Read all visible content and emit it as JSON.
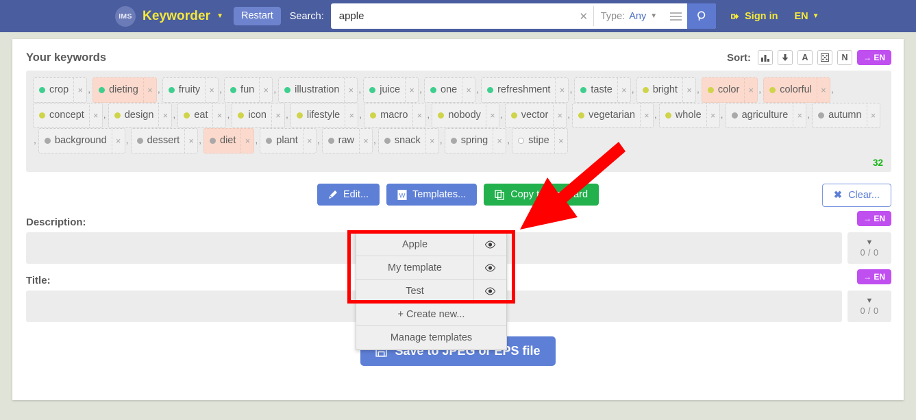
{
  "header": {
    "logo_text": "IMS",
    "brand": "Keyworder",
    "restart_label": "Restart",
    "search_label": "Search:",
    "search_value": "apple",
    "search_placeholder": "Search",
    "clear_icon": "close-icon",
    "type_label": "Type:",
    "type_value": "Any",
    "menu_icon": "hamburger-menu-icon",
    "search_icon": "magnifier-icon",
    "signin_label": "Sign in",
    "signin_icon": "sign-in-icon",
    "lang_label": "EN"
  },
  "keywords_panel": {
    "title": "Your keywords",
    "sort_label": "Sort:",
    "sort_buttons": [
      {
        "name": "sort-by-frequency",
        "icon": "bar-chart-icon",
        "label": ""
      },
      {
        "name": "sort-descending",
        "icon": "arrow-down-icon",
        "label": ""
      },
      {
        "name": "sort-alphabetical",
        "icon": "",
        "label": "A"
      },
      {
        "name": "sort-random",
        "icon": "dice-icon",
        "label": ""
      },
      {
        "name": "sort-natural",
        "icon": "",
        "label": "N"
      }
    ],
    "translate_label": "→ EN",
    "count": "32",
    "remove_icon": "close-icon",
    "separator": ",",
    "keywords": [
      {
        "text": "crop",
        "color": "#3ecf8e",
        "highlight": false
      },
      {
        "text": "dieting",
        "color": "#3ecf8e",
        "highlight": true
      },
      {
        "text": "fruity",
        "color": "#3ecf8e",
        "highlight": false
      },
      {
        "text": "fun",
        "color": "#3ecf8e",
        "highlight": false
      },
      {
        "text": "illustration",
        "color": "#3ecf8e",
        "highlight": false
      },
      {
        "text": "juice",
        "color": "#3ecf8e",
        "highlight": false
      },
      {
        "text": "one",
        "color": "#3ecf8e",
        "highlight": false
      },
      {
        "text": "refreshment",
        "color": "#3ecf8e",
        "highlight": false
      },
      {
        "text": "taste",
        "color": "#3ecf8e",
        "highlight": false
      },
      {
        "text": "bright",
        "color": "#cfd44a",
        "highlight": false
      },
      {
        "text": "color",
        "color": "#cfd44a",
        "highlight": true
      },
      {
        "text": "colorful",
        "color": "#cfd44a",
        "highlight": true
      },
      {
        "text": "concept",
        "color": "#cfd44a",
        "highlight": false
      },
      {
        "text": "design",
        "color": "#cfd44a",
        "highlight": false
      },
      {
        "text": "eat",
        "color": "#cfd44a",
        "highlight": false
      },
      {
        "text": "icon",
        "color": "#cfd44a",
        "highlight": false
      },
      {
        "text": "lifestyle",
        "color": "#cfd44a",
        "highlight": false
      },
      {
        "text": "macro",
        "color": "#cfd44a",
        "highlight": false
      },
      {
        "text": "nobody",
        "color": "#cfd44a",
        "highlight": false
      },
      {
        "text": "vector",
        "color": "#cfd44a",
        "highlight": false
      },
      {
        "text": "vegetarian",
        "color": "#cfd44a",
        "highlight": false
      },
      {
        "text": "whole",
        "color": "#cfd44a",
        "highlight": false
      },
      {
        "text": "agriculture",
        "color": "#a9a9a9",
        "highlight": false
      },
      {
        "text": "autumn",
        "color": "#a9a9a9",
        "highlight": false
      },
      {
        "text": "background",
        "color": "#a9a9a9",
        "highlight": false
      },
      {
        "text": "dessert",
        "color": "#a9a9a9",
        "highlight": false
      },
      {
        "text": "diet",
        "color": "#a9a9a9",
        "highlight": true
      },
      {
        "text": "plant",
        "color": "#a9a9a9",
        "highlight": false
      },
      {
        "text": "raw",
        "color": "#a9a9a9",
        "highlight": false
      },
      {
        "text": "snack",
        "color": "#a9a9a9",
        "highlight": false
      },
      {
        "text": "spring",
        "color": "#a9a9a9",
        "highlight": false
      },
      {
        "text": "stipe",
        "color": "#ffffff",
        "highlight": false
      }
    ]
  },
  "actions": {
    "edit_label": "Edit...",
    "edit_icon": "pencil-icon",
    "templates_label": "Templates...",
    "templates_icon": "document-icon",
    "copy_label": "Copy to clipboard",
    "copy_icon": "copy-icon",
    "clear_label": "Clear...",
    "clear_icon": "x-mark-icon"
  },
  "templates_dropdown": {
    "items": [
      {
        "label": "Apple",
        "eye_icon": "eye-icon"
      },
      {
        "label": "My template",
        "eye_icon": "eye-icon"
      },
      {
        "label": "Test",
        "eye_icon": "eye-icon"
      }
    ],
    "create_new_label": "+ Create new...",
    "manage_label": "Manage templates"
  },
  "description": {
    "label": "Description:",
    "value": "",
    "translate_label": "→ EN",
    "counter": "0 / 0",
    "expand_icon": "chevron-down-icon"
  },
  "title_field": {
    "label": "Title:",
    "value": "",
    "translate_label": "→ EN",
    "counter": "0 / 0",
    "expand_icon": "chevron-down-icon"
  },
  "save": {
    "label": "Save to JPEG or EPS file",
    "icon": "floppy-disk-icon"
  },
  "annotations": {
    "highlight_box_color": "#ff0000",
    "arrow_color": "#ff0000"
  },
  "colors": {
    "navbar": "#4a5d9e",
    "page_bg": "#dfe3d8",
    "accent_yellow": "#f5e93c",
    "primary_blue": "#5d7fd6",
    "green": "#22b14c",
    "purple": "#c04ff0",
    "count_green": "#14b414"
  }
}
